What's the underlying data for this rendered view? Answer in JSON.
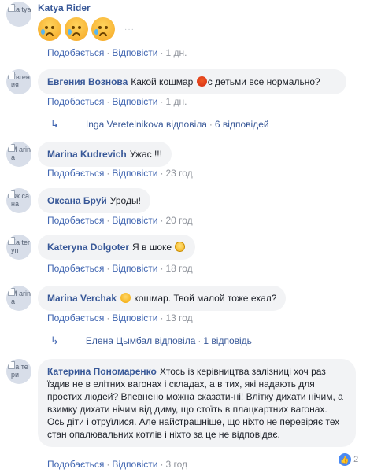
{
  "comments": [
    {
      "author": "Katya Rider",
      "avatar_alt": "Ka tya",
      "text": "",
      "emojis": [
        "weary-face",
        "weary-face",
        "weary-face"
      ],
      "like": "Подобається",
      "reply": "Відповісти",
      "time": "1 дн."
    },
    {
      "author": "Евгения Вознова",
      "avatar_alt": "Евгения",
      "text_before": "Какой кошмар",
      "emoji": "angry-face",
      "text_after": "с детьми все нормально?",
      "like": "Подобається",
      "reply": "Відповісти",
      "time": "1 дн.",
      "replies_link": {
        "name": "Inga Veretelnikova відповіла",
        "count": "6 відповідей"
      }
    },
    {
      "author": "Marina Kudrevich",
      "avatar_alt": "M arina",
      "text": "Ужас !!!",
      "like": "Подобається",
      "reply": "Відповісти",
      "time": "23 год"
    },
    {
      "author": "Оксана Бруй",
      "avatar_alt": "Ок сана",
      "text": "Уроды!",
      "like": "Подобається",
      "reply": "Відповісти",
      "time": "20 год"
    },
    {
      "author": "Kateryna Dolgoter",
      "avatar_alt": "Ka teryn",
      "text_before": "Я в шоке",
      "emoji": "screaming-face",
      "like": "Подобається",
      "reply": "Відповісти",
      "time": "18 год"
    },
    {
      "author": "Marina Verchak",
      "avatar_alt": "M arina",
      "emoji": "astonished-face",
      "text_after": "кошмар. Твой малой тоже ехал?",
      "like": "Подобається",
      "reply": "Відповісти",
      "time": "13 год",
      "replies_link": {
        "name": "Елена Цымбал відповіла",
        "count": "1 відповідь"
      }
    },
    {
      "author": "Катерина Пономаренко",
      "avatar_alt": "Ка тери",
      "text": "Хтось із керівництва залізниці хоч раз їздив не в елітних вагонах і складах, а в тих, які надають для простих людей? Впевнено можна сказати-ні! Влітку дихати нічим, а взимку дихати нічим від диму, що стоїть в плацкартних вагонах. Ось діти і отруїлися. Але найстрашніше, що ніхто не перевіряє тех стан опалювальних котлів і ніхто за це не відповідає.",
      "like": "Подобається",
      "reply": "Відповісти",
      "time": "3 год",
      "reaction_count": "2"
    }
  ],
  "colors": {
    "author": "#385898",
    "link": "#4267b2",
    "meta": "#90949c",
    "bubble": "#f2f3f5"
  }
}
